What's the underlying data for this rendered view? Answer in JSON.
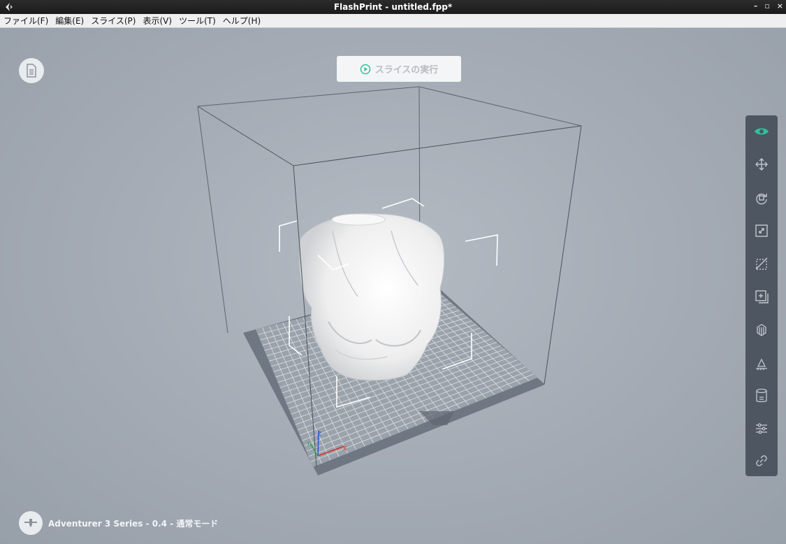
{
  "window": {
    "title": "FlashPrint - untitled.fpp*",
    "controls": [
      "–",
      "▫",
      "×"
    ]
  },
  "menu": [
    {
      "label": "ファイル(F)"
    },
    {
      "label": "編集(E)"
    },
    {
      "label": "スライス(P)"
    },
    {
      "label": "表示(V)"
    },
    {
      "label": "ツール(T)"
    },
    {
      "label": "ヘルプ(H)"
    }
  ],
  "slice_button": {
    "label": "スライスの実行",
    "icon": "play-circle-icon"
  },
  "toolbar": {
    "items": [
      {
        "name": "view-icon",
        "active": true
      },
      {
        "name": "move-icon"
      },
      {
        "name": "rotate-icon"
      },
      {
        "name": "scale-icon"
      },
      {
        "name": "cut-icon"
      },
      {
        "name": "add-part-icon"
      },
      {
        "name": "supports-icon"
      },
      {
        "name": "lay-flat-icon"
      },
      {
        "name": "raft-icon"
      },
      {
        "name": "settings-sliders-icon"
      },
      {
        "name": "link-icon"
      }
    ]
  },
  "axes": {
    "z": "Z",
    "x": "X",
    "y": "Y"
  },
  "status": {
    "machine": "Adventurer 3 Series - 0.4 - 通常モード"
  },
  "colors": {
    "accent": "#2fc29e",
    "toolbar": "#4d5661",
    "viewport": "#a6adb6"
  }
}
